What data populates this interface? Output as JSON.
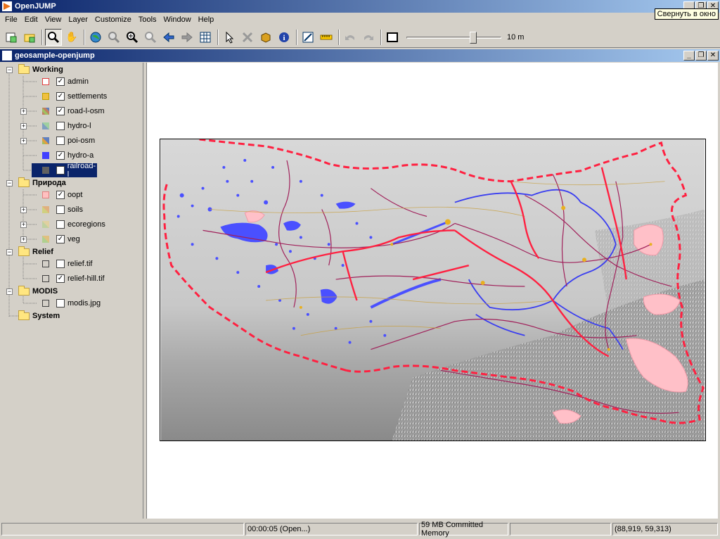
{
  "window": {
    "title": "OpenJUMP",
    "tooltip": "Свернуть в окно"
  },
  "menu": [
    "File",
    "Edit",
    "View",
    "Layer",
    "Customize",
    "Tools",
    "Window",
    "Help"
  ],
  "toolbar": {
    "scale_label": "10 m"
  },
  "inner_window": {
    "title": "geosample-openjump"
  },
  "tree": {
    "categories": [
      {
        "name": "Working",
        "layers": [
          {
            "name": "admin",
            "checked": true,
            "color": "#e0a0a0"
          },
          {
            "name": "settlements",
            "checked": true,
            "color": "#f0c040"
          },
          {
            "name": "road-l-osm",
            "checked": true,
            "color": "#c08060"
          },
          {
            "name": "hydro-l",
            "checked": false,
            "color": "#80a0c0"
          },
          {
            "name": "poi-osm",
            "checked": false,
            "color": "#a0c060"
          },
          {
            "name": "hydro-a",
            "checked": true,
            "color": "#4040ff"
          },
          {
            "name": "railroad-l",
            "checked": false,
            "color": "#606060"
          }
        ]
      },
      {
        "name": "Природа",
        "layers": [
          {
            "name": "oopt",
            "checked": true,
            "color": "#ffc0c0"
          },
          {
            "name": "soils",
            "checked": false,
            "color": "#d0d080"
          },
          {
            "name": "ecoregions",
            "checked": false,
            "color": "#c0d0a0"
          },
          {
            "name": "veg",
            "checked": true,
            "color": "#b0d090"
          }
        ]
      },
      {
        "name": "Relief",
        "layers": [
          {
            "name": "relief.tif",
            "checked": false,
            "color": "#d4d0c8"
          },
          {
            "name": "relief-hill.tif",
            "checked": true,
            "color": "#d4d0c8"
          }
        ]
      },
      {
        "name": "MODIS",
        "layers": [
          {
            "name": "modis.jpg",
            "checked": false,
            "color": "#d4d0c8"
          }
        ]
      },
      {
        "name": "System",
        "layers": []
      }
    ]
  },
  "status": {
    "timer": "00:00:05 (Open...)",
    "memory": "59 MB Committed Memory",
    "coords": "(88,919, 59,313)"
  }
}
